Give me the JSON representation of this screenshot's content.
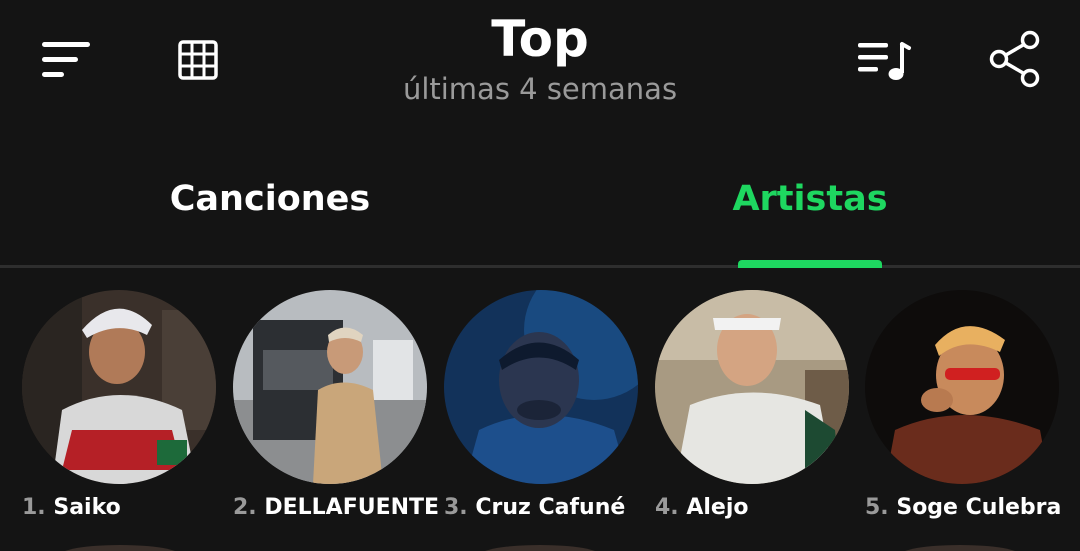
{
  "header": {
    "title": "Top",
    "subtitle": "últimas 4 semanas",
    "icons": [
      "menu-icon",
      "grid-icon",
      "playlist-icon",
      "share-icon"
    ]
  },
  "tabs": [
    {
      "label": "Canciones",
      "active": false
    },
    {
      "label": "Artistas",
      "active": true
    }
  ],
  "accent_color": "#1ed760",
  "artists": [
    {
      "rank": "1.",
      "name": "Saiko"
    },
    {
      "rank": "2.",
      "name": "DELLAFUENTE"
    },
    {
      "rank": "3.",
      "name": "Cruz Cafuné"
    },
    {
      "rank": "4.",
      "name": "Alejo"
    },
    {
      "rank": "5.",
      "name": "Soge Culebra"
    }
  ]
}
